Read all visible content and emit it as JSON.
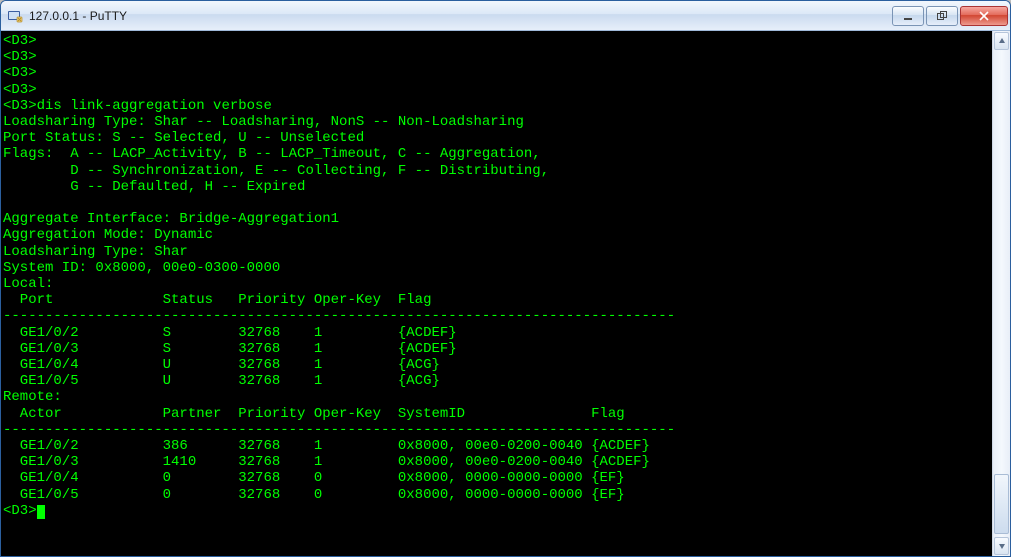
{
  "window": {
    "title": "127.0.0.1 - PuTTY"
  },
  "terminal": {
    "prompt": "<D3>",
    "command": "dis link-aggregation verbose",
    "header": {
      "line1": "Loadsharing Type: Shar -- Loadsharing, NonS -- Non-Loadsharing",
      "line2": "Port Status: S -- Selected, U -- Unselected",
      "flags1": "Flags:  A -- LACP_Activity, B -- LACP_Timeout, C -- Aggregation,",
      "flags2": "        D -- Synchronization, E -- Collecting, F -- Distributing,",
      "flags3": "        G -- Defaulted, H -- Expired"
    },
    "agg": {
      "interface": "Aggregate Interface: Bridge-Aggregation1",
      "mode": "Aggregation Mode: Dynamic",
      "lstype": "Loadsharing Type: Shar",
      "sysid": "System ID: 0x8000, 00e0-0300-0000"
    },
    "local": {
      "title": "Local:",
      "cols": "  Port             Status   Priority Oper-Key  Flag",
      "sep": "--------------------------------------------------------------------------------",
      "rows": [
        "  GE1/0/2          S        32768    1         {ACDEF}",
        "  GE1/0/3          S        32768    1         {ACDEF}",
        "  GE1/0/4          U        32768    1         {ACG}",
        "  GE1/0/5          U        32768    1         {ACG}"
      ]
    },
    "remote": {
      "title": "Remote:",
      "cols": "  Actor            Partner  Priority Oper-Key  SystemID               Flag",
      "sep": "--------------------------------------------------------------------------------",
      "rows": [
        "  GE1/0/2          386      32768    1         0x8000, 00e0-0200-0040 {ACDEF}",
        "  GE1/0/3          1410     32768    1         0x8000, 00e0-0200-0040 {ACDEF}",
        "  GE1/0/4          0        32768    0         0x8000, 0000-0000-0000 {EF}",
        "  GE1/0/5          0        32768    0         0x8000, 0000-0000-0000 {EF}"
      ]
    }
  }
}
